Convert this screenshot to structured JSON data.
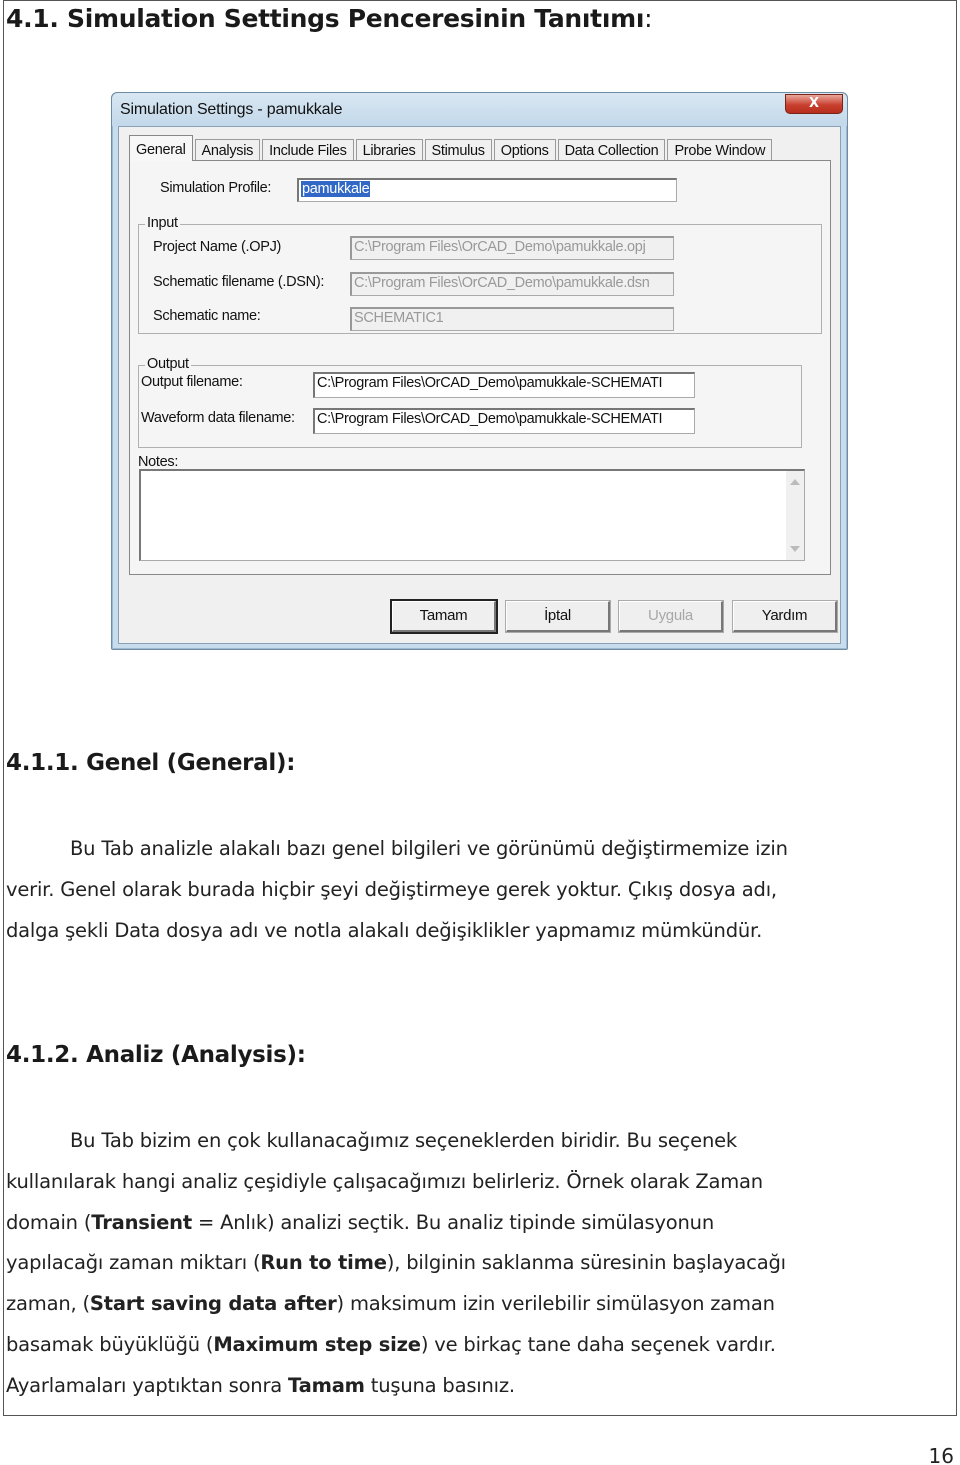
{
  "heading": {
    "title": "4.1. Simulation Settings Penceresinin Tanıtımı",
    "colon": ":"
  },
  "dialog": {
    "title": "Simulation Settings - pamukkale",
    "close_glyph": "X",
    "tabs": [
      {
        "label": "General",
        "active": true
      },
      {
        "label": "Analysis",
        "active": false
      },
      {
        "label": "Include Files",
        "active": false
      },
      {
        "label": "Libraries",
        "active": false
      },
      {
        "label": "Stimulus",
        "active": false
      },
      {
        "label": "Options",
        "active": false
      },
      {
        "label": "Data Collection",
        "active": false
      },
      {
        "label": "Probe Window",
        "active": false
      }
    ],
    "simulation_profile": {
      "label": "Simulation Profile:",
      "value": "pamukkale"
    },
    "input_group": {
      "legend": "Input",
      "project_name": {
        "label": "Project Name (.OPJ)",
        "value": "C:\\Program Files\\OrCAD_Demo\\pamukkale.opj"
      },
      "schematic_filename": {
        "label": "Schematic filename (.DSN):",
        "value": "C:\\Program Files\\OrCAD_Demo\\pamukkale.dsn"
      },
      "schematic_name": {
        "label": "Schematic name:",
        "value": "SCHEMATIC1"
      }
    },
    "output_group": {
      "legend": "Output",
      "output_filename": {
        "label": "Output filename:",
        "value": "C:\\Program Files\\OrCAD_Demo\\pamukkale-SCHEMATI"
      },
      "waveform_filename": {
        "label": "Waveform data filename:",
        "value": "C:\\Program Files\\OrCAD_Demo\\pamukkale-SCHEMATI"
      }
    },
    "notes": {
      "label": "Notes:",
      "value": ""
    },
    "buttons": {
      "ok": "Tamam",
      "cancel": "İptal",
      "apply": "Uygula",
      "help": "Yardım"
    }
  },
  "section_general": {
    "title": "4.1.1. Genel (General):",
    "lines": [
      "Bu Tab analizle alakalı bazı genel bilgileri ve görünümü değiştirmemize izin",
      "verir. Genel olarak burada hiçbir şeyi değiştirmeye gerek yoktur. Çıkış dosya adı,",
      "dalga şekli Data dosya adı ve notla alakalı değişiklikler yapmamız mümkündür."
    ]
  },
  "section_analysis": {
    "title": "4.1.2. Analiz (Analysis):",
    "line1": "Bu Tab bizim en çok kullanacağımız seçeneklerden biridir. Bu seçenek",
    "line2": "kullanılarak hangi analiz çeşidiyle çalışacağımızı belirleriz. Örnek olarak Zaman",
    "line3": {
      "a": "domain (",
      "b": "Transient",
      "c": " = Anlık) analizi seçtik. Bu analiz tipinde simülasyonun"
    },
    "line4": {
      "a": "yapılacağı zaman miktarı (",
      "b": "Run to time",
      "c": "), bilginin saklanma süresinin başlayacağı"
    },
    "line5": {
      "a": "zaman, (",
      "b": "Start saving data after",
      "c": ") maksimum izin verilebilir simülasyon zaman"
    },
    "line6": {
      "a": "basamak büyüklüğü (",
      "b": "Maximum step size",
      "c": ") ve birkaç tane daha seçenek vardır."
    },
    "line7": {
      "a": "Ayarlamaları yaptıktan sonra ",
      "b": "Tamam",
      "c": " tuşuna basınız."
    }
  },
  "page_number": "16"
}
